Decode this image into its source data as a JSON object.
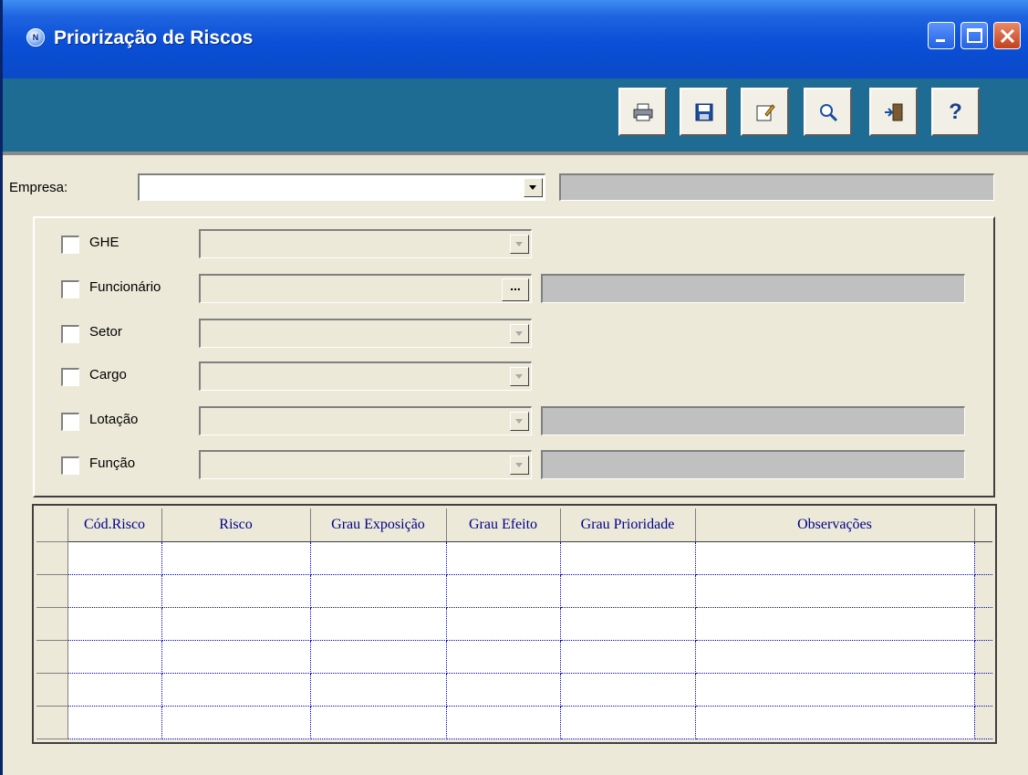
{
  "window": {
    "title": "Priorização de Riscos",
    "icon_letter": "N"
  },
  "toolbar": {
    "buttons": [
      {
        "name": "print",
        "icon": "printer-icon"
      },
      {
        "name": "save",
        "icon": "floppy-disk-icon"
      },
      {
        "name": "edit",
        "icon": "edit-note-icon"
      },
      {
        "name": "search",
        "icon": "magnifier-icon"
      },
      {
        "name": "exit",
        "icon": "exit-door-icon"
      },
      {
        "name": "help",
        "icon": "question-mark-icon",
        "label": "?"
      }
    ]
  },
  "form": {
    "empresa_label": "Empresa:",
    "empresa_value": "",
    "empresa_desc": "",
    "filters": [
      {
        "label": "GHE",
        "checked": false
      },
      {
        "label": "Funcionário",
        "checked": false,
        "ellipsis": "..."
      },
      {
        "label": "Setor",
        "checked": false
      },
      {
        "label": "Cargo",
        "checked": false
      },
      {
        "label": "Lotação",
        "checked": false
      },
      {
        "label": "Função",
        "checked": false
      }
    ]
  },
  "grid": {
    "columns": [
      "Cód.Risco",
      "Risco",
      "Grau Exposição",
      "Grau Efeito",
      "Grau Prioridade",
      "Observações"
    ],
    "row_count": 6
  },
  "colors": {
    "title_bar": "#0A4FD6",
    "toolbar_band": "#1E6C94",
    "window_face": "#ECE9D8",
    "grid_header_text": "#00008B"
  }
}
